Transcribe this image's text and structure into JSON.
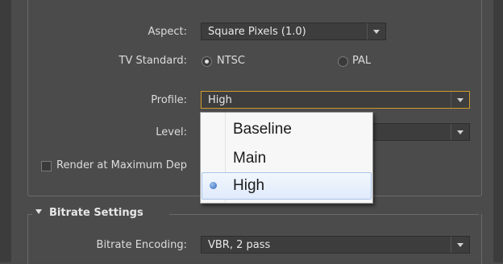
{
  "aspect": {
    "label": "Aspect:",
    "value": "Square Pixels (1.0)"
  },
  "tv_standard": {
    "label": "TV Standard:",
    "options": [
      "NTSC",
      "PAL"
    ],
    "selected": "NTSC"
  },
  "profile": {
    "label": "Profile:",
    "value": "High"
  },
  "level": {
    "label": "Level:"
  },
  "render_max_depth": {
    "label": "Render at Maximum Dep",
    "checked": false
  },
  "profile_menu": {
    "items": [
      "Baseline",
      "Main",
      "High"
    ],
    "selected": "High"
  },
  "bitrate_section": {
    "title": "Bitrate Settings"
  },
  "bitrate_encoding": {
    "label": "Bitrate Encoding:",
    "value": "VBR, 2 pass"
  },
  "colors": {
    "focus_border": "#d19b2a",
    "selection": "#dfeafb",
    "panel": "#4b4b4b"
  }
}
